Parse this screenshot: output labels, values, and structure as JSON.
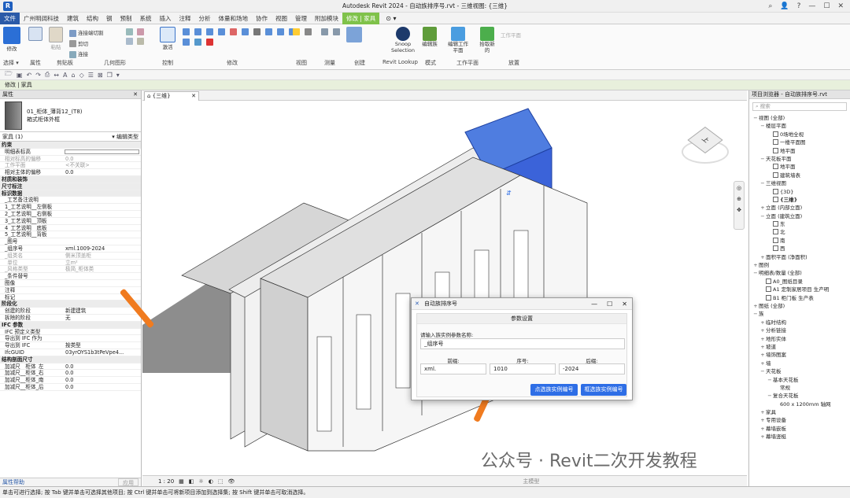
{
  "titlebar": {
    "title": "Autodesk Revit 2024 - 自动族排序号.rvt - 三维视图: {三维}",
    "app_letter": "R"
  },
  "tabs": [
    "文件",
    "广州明阔科技",
    "建筑",
    "结构",
    "钢",
    "预制",
    "系统",
    "插入",
    "注释",
    "分析",
    "体量和场地",
    "协作",
    "视图",
    "管理",
    "附加模块",
    "修改 | 家具"
  ],
  "ribbon": {
    "modify_label": "修改",
    "paste_label": "粘贴",
    "join_cut": "连接端切割",
    "cut": "剪切",
    "connect": "连接",
    "activate": "激活",
    "snoop": "Snoop Selection",
    "edit_family": "编辑族",
    "edit_workplane": "编辑工作平面",
    "pick_new": "拾取新的",
    "workplane": "工作平面"
  },
  "panels": [
    "选择 ▾",
    "属性",
    "剪贴板",
    "几何图形",
    "控制",
    "修改",
    "视图",
    "测量",
    "创建",
    "Revit Lookup",
    "模式",
    "工作平面",
    "放置"
  ],
  "options_bar": "修改 | 家具",
  "properties": {
    "header": "属性",
    "type_name": "01_柜体_薄背12_(T8)",
    "type_sub": "箱式柜体外框",
    "instance_count": "家具 (1)",
    "edit_type": "编辑类型",
    "help": "属性帮助",
    "apply": "应用",
    "rows": [
      {
        "k": "约束",
        "g": true
      },
      {
        "k": "明细表标高",
        "v": ""
      },
      {
        "k": "相对标高的偏移",
        "v": "0.0",
        "ro": true
      },
      {
        "k": "工作平面",
        "v": "<不关联>",
        "ro": true
      },
      {
        "k": "相对主体的偏移",
        "v": "0.0"
      },
      {
        "k": "材质和装饰",
        "g": true
      },
      {
        "k": "尺寸标注",
        "g": true
      },
      {
        "k": "标识数据",
        "g": true
      },
      {
        "k": "_工艺备注说明",
        "v": ""
      },
      {
        "k": "1_工艺说明__左侧板",
        "v": ""
      },
      {
        "k": "2_工艺说明__右侧板",
        "v": ""
      },
      {
        "k": "3_工艺说明__顶板",
        "v": ""
      },
      {
        "k": "4_工艺说明__底板",
        "v": ""
      },
      {
        "k": "5_工艺说明__背板",
        "v": ""
      },
      {
        "k": "_图号",
        "v": ""
      },
      {
        "k": "_组序号",
        "v": "xml.1009-2024"
      },
      {
        "k": "_组类名",
        "v": "侧米顶盖柜",
        "ro": true
      },
      {
        "k": "_单位",
        "v": "立m²",
        "ro": true
      },
      {
        "k": "_风格类型",
        "v": "极简_柜体类",
        "ro": true
      },
      {
        "k": "_条件替号",
        "v": ""
      },
      {
        "k": "图像",
        "v": ""
      },
      {
        "k": "注释",
        "v": ""
      },
      {
        "k": "标记",
        "v": ""
      },
      {
        "k": "阶段化",
        "g": true
      },
      {
        "k": "创建的阶段",
        "v": "新建建筑"
      },
      {
        "k": "拆除的阶段",
        "v": "无"
      },
      {
        "k": "IFC 参数",
        "g": true
      },
      {
        "k": "IFC 预定义类型",
        "v": ""
      },
      {
        "k": "导出到 IFC 作为",
        "v": ""
      },
      {
        "k": "导出到 IFC",
        "v": "按类型"
      },
      {
        "k": "IfcGUID",
        "v": "03yrOYS1b3tPeVpe4..."
      },
      {
        "k": "结构剖面尺寸",
        "g": true
      },
      {
        "k": "加减尺__柜体_左",
        "v": "0.0"
      },
      {
        "k": "加减尺__柜体_右",
        "v": "0.0"
      },
      {
        "k": "加减尺__柜体_南",
        "v": "0.0"
      },
      {
        "k": "加减尺__柜体_后",
        "v": "0.0"
      }
    ]
  },
  "view": {
    "tab_label": "{三维}",
    "scale": "1 : 20",
    "main_model": "主模型",
    "viewcube_face": "上"
  },
  "browser": {
    "title": "项目浏览器 - 自动族排序号.rvt",
    "search_placeholder": "搜索",
    "items": [
      {
        "t": "视图 (全部)",
        "lv": 0,
        "tg": "−"
      },
      {
        "t": "楼层平面",
        "lv": 1,
        "tg": "−"
      },
      {
        "t": "0场地全视",
        "lv": 2,
        "c": true
      },
      {
        "t": "一楼平面图",
        "lv": 2,
        "c": true
      },
      {
        "t": "地平面",
        "lv": 2,
        "c": true
      },
      {
        "t": "天花板平面",
        "lv": 1,
        "tg": "−"
      },
      {
        "t": "地平面",
        "lv": 2,
        "c": true
      },
      {
        "t": "建筑墙表",
        "lv": 2,
        "c": true
      },
      {
        "t": "三维视图",
        "lv": 1,
        "tg": "−"
      },
      {
        "t": "{3D}",
        "lv": 2,
        "c": true
      },
      {
        "t": "{三维}",
        "lv": 2,
        "c": true,
        "b": true
      },
      {
        "t": "立面 (内部立面)",
        "lv": 1,
        "tg": "+"
      },
      {
        "t": "立面 (建筑立面)",
        "lv": 1,
        "tg": "−"
      },
      {
        "t": "东",
        "lv": 2,
        "c": true
      },
      {
        "t": "北",
        "lv": 2,
        "c": true
      },
      {
        "t": "南",
        "lv": 2,
        "c": true
      },
      {
        "t": "西",
        "lv": 2,
        "c": true
      },
      {
        "t": "面积平面 (净面积)",
        "lv": 1,
        "tg": "+"
      },
      {
        "t": "图例",
        "lv": 0,
        "tg": "+"
      },
      {
        "t": "明细表/数量 (全部)",
        "lv": 0,
        "tg": "−"
      },
      {
        "t": "A0_图纸目录",
        "lv": 1,
        "c": true
      },
      {
        "t": "A1 定制家居项目 生产明",
        "lv": 1,
        "c": true
      },
      {
        "t": "B1 柜门板 生产表",
        "lv": 1,
        "c": true
      },
      {
        "t": "图纸 (全部)",
        "lv": 0,
        "tg": "+"
      },
      {
        "t": "族",
        "lv": 0,
        "tg": "−"
      },
      {
        "t": "临时结构",
        "lv": 1,
        "tg": "+"
      },
      {
        "t": "分析链接",
        "lv": 1,
        "tg": "+"
      },
      {
        "t": "地形实体",
        "lv": 1,
        "tg": "+"
      },
      {
        "t": "坡道",
        "lv": 1,
        "tg": "+"
      },
      {
        "t": "墙饰图案",
        "lv": 1,
        "tg": "+"
      },
      {
        "t": "墙",
        "lv": 1,
        "tg": "+"
      },
      {
        "t": "天花板",
        "lv": 1,
        "tg": "−"
      },
      {
        "t": "基本天花板",
        "lv": 2,
        "tg": "−"
      },
      {
        "t": "常规",
        "lv": 3
      },
      {
        "t": "复合天花板",
        "lv": 2,
        "tg": "−"
      },
      {
        "t": "600 x 1200mm 轴网",
        "lv": 3
      },
      {
        "t": "家具",
        "lv": 1,
        "tg": "+"
      },
      {
        "t": "专用设备",
        "lv": 1,
        "tg": "+"
      },
      {
        "t": "幕墙嵌板",
        "lv": 1,
        "tg": "+"
      },
      {
        "t": "幕墙竖梃",
        "lv": 1,
        "tg": "+"
      }
    ]
  },
  "status_text": "单击可进行选择; 按 Tab 键并单击可选择其他项目; 按 Ctrl 键并单击可将新项目添加到选择集; 按 Shift 键并单击可取消选择。",
  "dialog": {
    "title": "自动族排序号",
    "section": "参数设置",
    "prompt": "请输入族实例参数名称:",
    "param_value": "_组序号",
    "prefix_label": "前缀:",
    "seq_label": "序号:",
    "suffix_label": "后缀:",
    "prefix": "xml.",
    "seq": "1010",
    "suffix": "-2024",
    "btn_click": "点选族实例编号",
    "btn_box": "框选族实例编号"
  },
  "watermark": "公众号 · Revit二次开发教程",
  "colors": {
    "accent": "#2e6ee6",
    "file_tab": "#2b5aa8",
    "context_tab": "#7fc24a",
    "arrow": "#f07b1f",
    "selection": "#3b63d9"
  }
}
